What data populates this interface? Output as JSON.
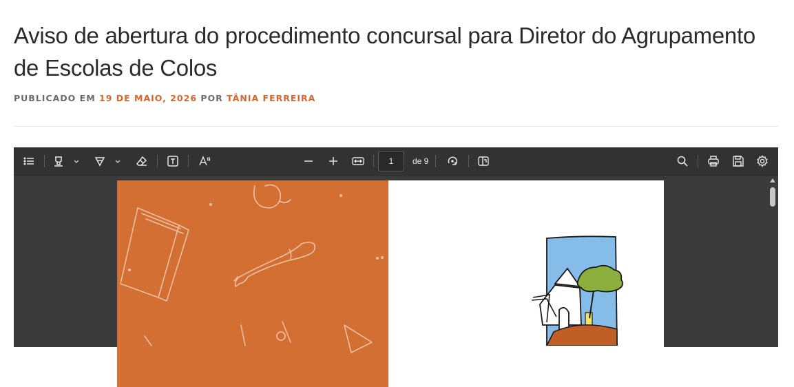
{
  "article": {
    "title": "Aviso de abertura do procedimento concursal para Diretor do Agrupamento de Escolas de Colos",
    "meta_published": "PUBLICADO EM",
    "meta_date": "19 DE MAIO, 2026",
    "meta_by": "POR",
    "meta_author": "TÂNIA FERREIRA"
  },
  "viewer": {
    "page_current": "1",
    "page_total": "de 9"
  },
  "colors": {
    "accent": "#d4662a",
    "cover": "#d46f33",
    "toolbar": "#323232",
    "viewer_bg": "#3a3a3a"
  },
  "icons": [
    "list-icon",
    "highlight-icon",
    "draw-icon",
    "eraser-icon",
    "text-box-icon",
    "text-style-icon",
    "zoom-out-icon",
    "zoom-in-icon",
    "fit-width-icon",
    "rotate-icon",
    "page-view-icon",
    "search-icon",
    "print-icon",
    "save-icon",
    "settings-icon"
  ]
}
